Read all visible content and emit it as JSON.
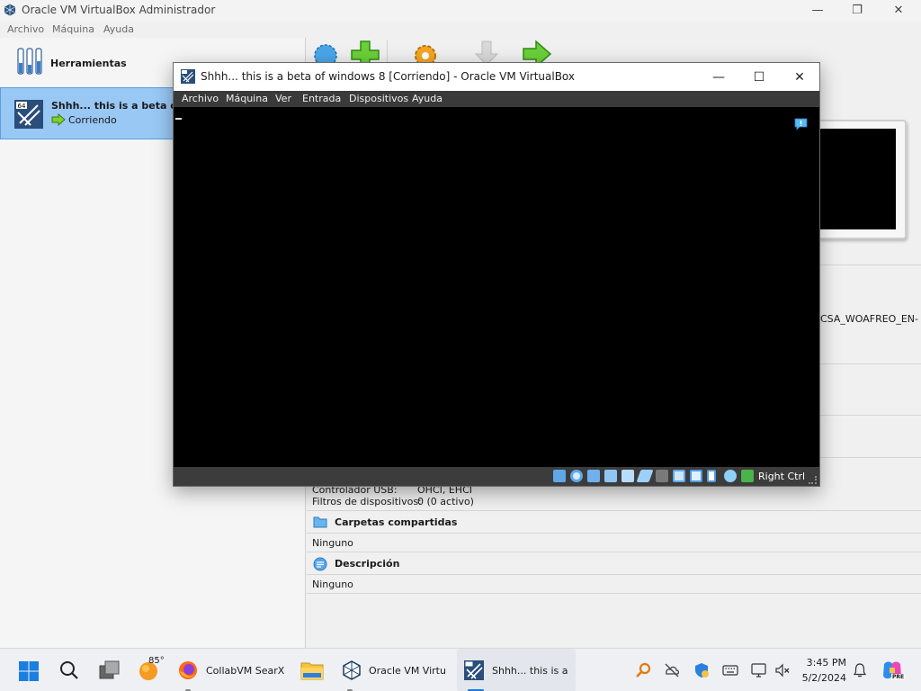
{
  "manager": {
    "title": "Oracle VM VirtualBox Administrador",
    "menu": [
      "Archivo",
      "Máquina",
      "Ayuda"
    ],
    "tools_label": "Herramientas",
    "vm_name": "Shhh... this is a beta of w",
    "vm_state": "Corriendo",
    "details": {
      "partial_text": "CSA_WOAFREO_EN-",
      "usb_controller_label": "Controlador USB:",
      "usb_controller_value": "OHCI, EHCI",
      "usb_filters_label": "Filtros de dispositivos:",
      "usb_filters_value": "0 (0 activo)",
      "shared_folders_title": "Carpetas compartidas",
      "shared_folders_value": "Ninguno",
      "description_title": "Descripción",
      "description_value": "Ninguno"
    }
  },
  "vm_window": {
    "title": "Shhh... this is a beta of windows 8 [Corriendo] - Oracle VM VirtualBox",
    "menu": [
      "Archivo",
      "Máquina",
      "Ver",
      "Entrada",
      "Dispositivos",
      "Ayuda"
    ],
    "host_key": "Right Ctrl"
  },
  "taskbar": {
    "weather_temp": "85°",
    "items": [
      {
        "label": "CollabVM SearX"
      },
      {
        "label": "Oracle VM Virtu"
      },
      {
        "label": "Shhh... this is a l"
      }
    ],
    "time": "3:45 PM",
    "date": "5/2/2024",
    "copilot_badge": "PRE"
  },
  "colors": {
    "selection": "#99c8f5",
    "vm_menubar": "#3a3a3a",
    "taskbar_accent": "#1e7ae0"
  }
}
